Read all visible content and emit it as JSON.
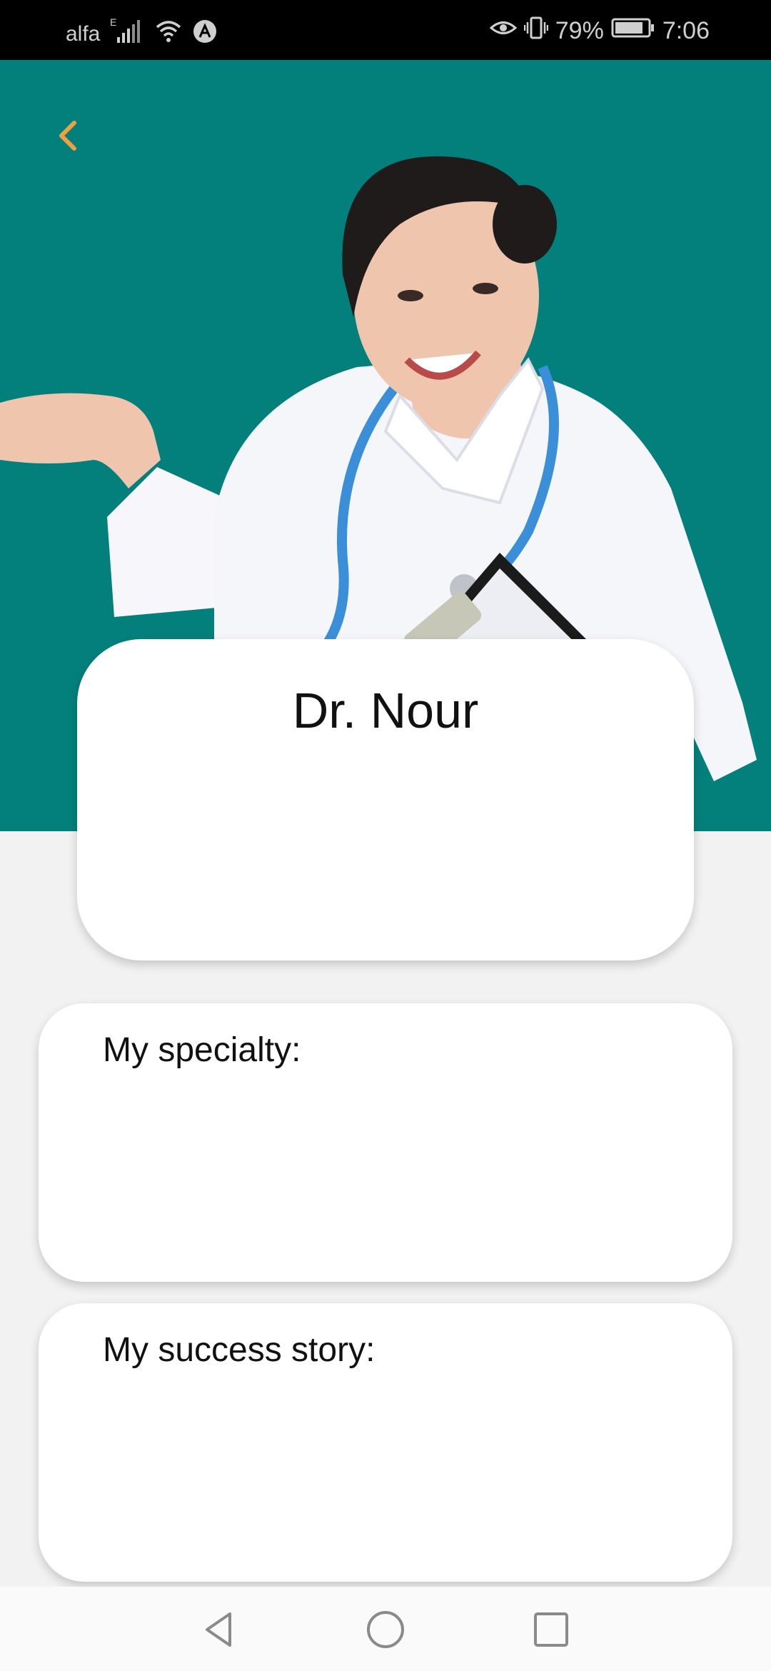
{
  "status_bar": {
    "carrier": "alfa",
    "network_type": "E",
    "battery_percent": "79%",
    "time": "7:06",
    "icons": [
      "signal-icon",
      "wifi-icon",
      "app-notification-icon",
      "eye-icon",
      "vibrate-icon",
      "battery-icon"
    ]
  },
  "header": {
    "back_icon": "chevron-left-icon",
    "colors": {
      "hero_background": "#04807c",
      "back_icon": "#f0a040"
    }
  },
  "profile": {
    "name": "Dr. Nour"
  },
  "sections": {
    "specialty_label": "My specialty:",
    "success_story_label": "My success story:"
  },
  "nav_bar": {
    "icons": [
      "back-triangle-icon",
      "home-circle-icon",
      "recents-square-icon"
    ]
  }
}
